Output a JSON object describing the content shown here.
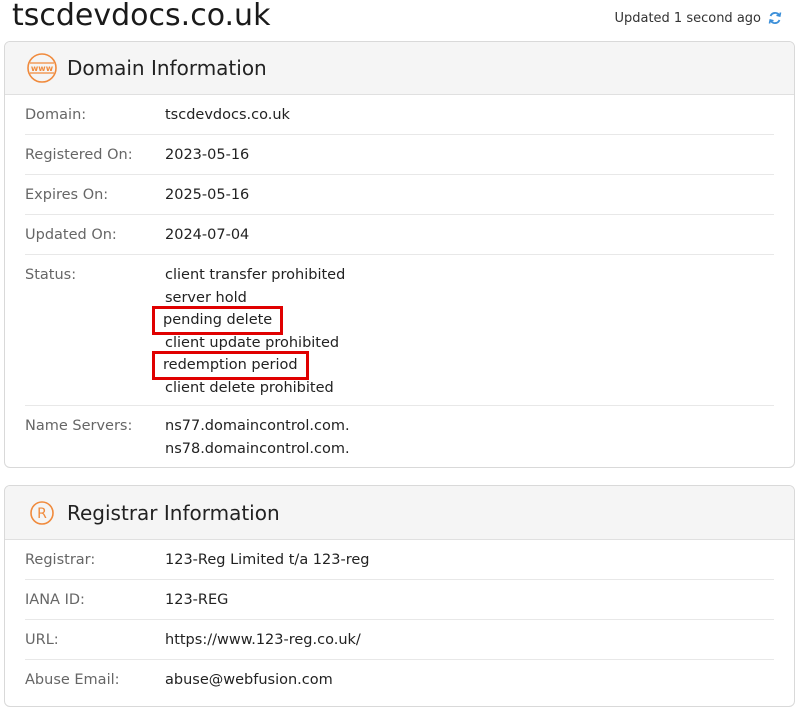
{
  "page": {
    "title": "tscdevdocs.co.uk",
    "updated": "Updated 1 second ago"
  },
  "icons": {
    "refresh": "refresh-icon",
    "domain": "www-icon",
    "registrar": "registered-icon"
  },
  "colors": {
    "accent_orange": "#f08a3c",
    "refresh_blue": "#3b8fd9",
    "highlight_red": "#e00000"
  },
  "domain_info": {
    "title": "Domain Information",
    "rows": [
      {
        "label": "Domain:",
        "values": [
          "tscdevdocs.co.uk"
        ]
      },
      {
        "label": "Registered On:",
        "values": [
          "2023-05-16"
        ]
      },
      {
        "label": "Expires On:",
        "values": [
          "2025-05-16"
        ]
      },
      {
        "label": "Updated On:",
        "values": [
          "2024-07-04"
        ]
      },
      {
        "label": "Status:",
        "values": [
          "client transfer prohibited",
          "server hold",
          "pending delete",
          "client update prohibited",
          "redemption period",
          "client delete prohibited"
        ]
      },
      {
        "label": "Name Servers:",
        "values": [
          "ns77.domaincontrol.com.",
          "ns78.domaincontrol.com."
        ]
      }
    ]
  },
  "registrar_info": {
    "title": "Registrar Information",
    "rows": [
      {
        "label": "Registrar:",
        "values": [
          "123-Reg Limited t/a 123-reg"
        ]
      },
      {
        "label": "IANA ID:",
        "values": [
          "123-REG"
        ]
      },
      {
        "label": "URL:",
        "values": [
          "https://www.123-reg.co.uk/"
        ]
      },
      {
        "label": "Abuse Email:",
        "values": [
          "abuse@webfusion.com"
        ]
      }
    ]
  }
}
